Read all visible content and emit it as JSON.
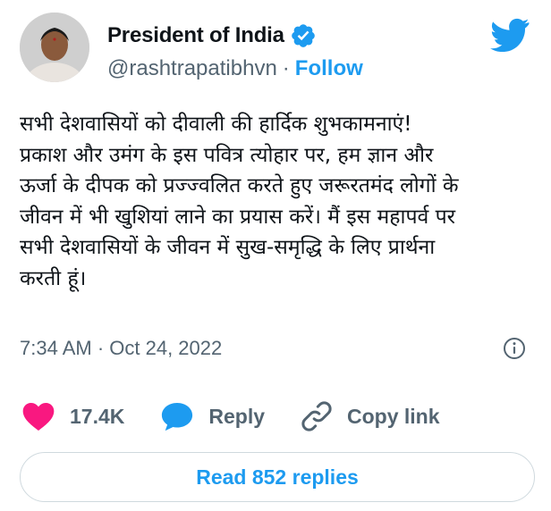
{
  "author": {
    "display_name": "President of India",
    "handle": "@rashtrapatibhvn",
    "separator": "·",
    "follow_label": "Follow",
    "verified": true
  },
  "tweet": {
    "text": "सभी देशवासियों को दीवाली की हार्दिक शुभकामनाएं!\nप्रकाश और उमंग के इस पवित्र त्योहार पर, हम ज्ञान और\nऊर्जा के दीपक को प्रज्ज्वलित करते हुए जरूरतमंद लोगों के\nजीवन में भी खुशियां लाने का प्रयास करें। मैं इस महापर्व पर\nसभी देशवासियों के जीवन में सुख-समृद्धि के लिए प्रार्थना\nकरती हूं।",
    "timestamp": "7:34 AM · Oct 24, 2022"
  },
  "actions": {
    "like_count": "17.4K",
    "reply_label": "Reply",
    "copy_link_label": "Copy link"
  },
  "read_replies_label": "Read 852 replies",
  "colors": {
    "accent": "#1d9bf0",
    "like": "#f91880",
    "muted": "#536471",
    "border": "#cfd9de"
  },
  "icons": {
    "verified": "verified-badge-icon",
    "brand": "twitter-bird-icon",
    "info": "info-icon",
    "like": "heart-icon",
    "reply": "speech-bubble-icon",
    "copy_link": "link-icon"
  }
}
